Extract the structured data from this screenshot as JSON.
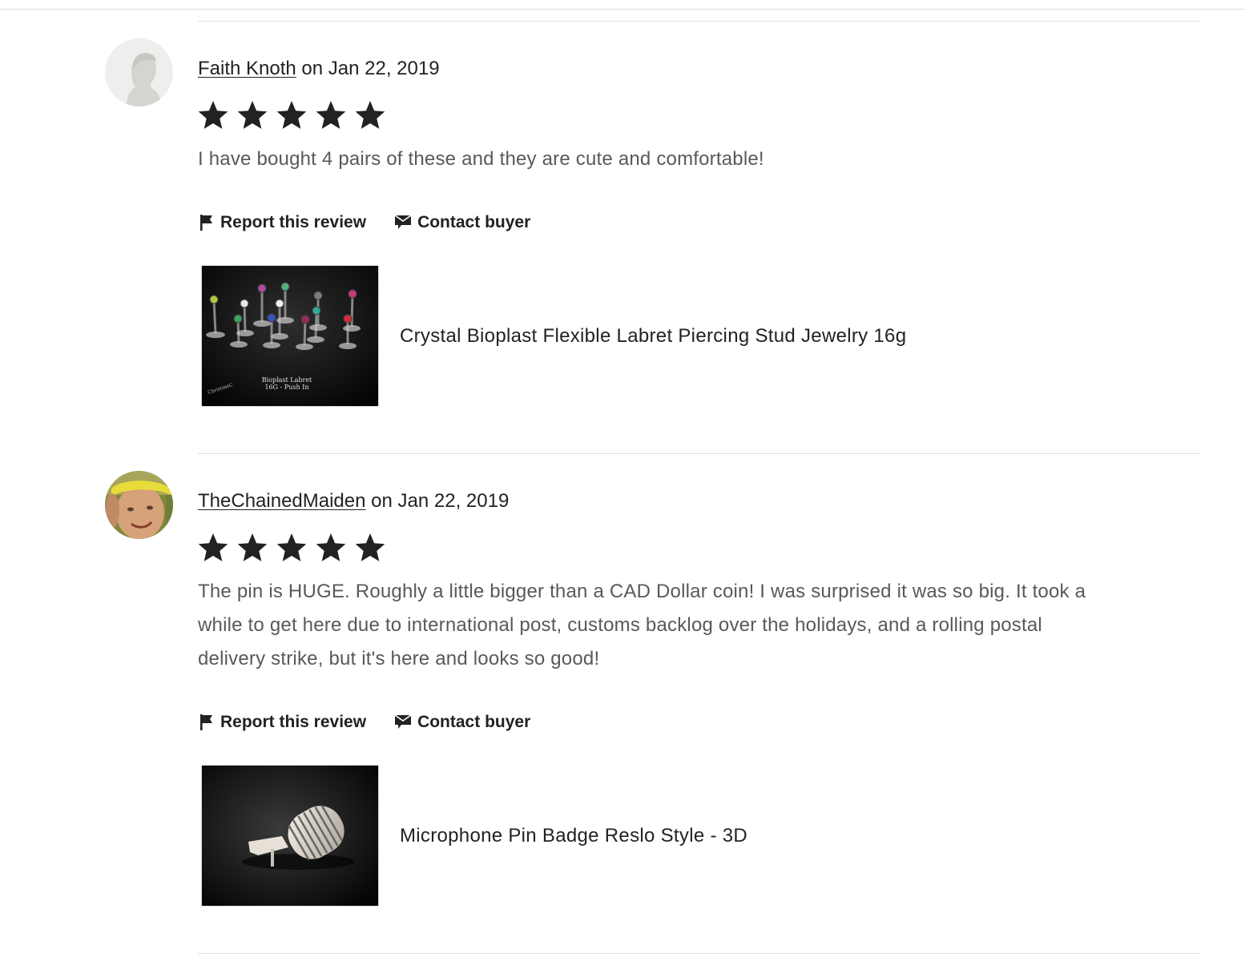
{
  "reviews": [
    {
      "reviewer": "Faith Knoth",
      "date_text": " on Jan 22, 2019",
      "rating": 5,
      "text": "I have bought 4 pairs of these and they are cute and comfortable!",
      "report_label": "Report this review",
      "contact_label": "Contact buyer",
      "listing_title": "Crystal Bioplast Flexible Labret Piercing Stud Jewelry 16g",
      "thumb_caption_1": "Bioplast Labret",
      "thumb_caption_2": "16G - Push In",
      "thumb_signature": "ChristineC"
    },
    {
      "reviewer": "TheChainedMaiden",
      "date_text": " on Jan 22, 2019",
      "rating": 5,
      "text": "The pin is HUGE. Roughly a little bigger than a CAD Dollar coin! I was surprised it was so big. It took a while to get here due to international post, customs backlog over the holidays, and a rolling postal delivery strike, but it's here and looks so good!",
      "report_label": "Report this review",
      "contact_label": "Contact buyer",
      "listing_title": "Microphone Pin Badge Reslo Style - 3D"
    }
  ],
  "colors": {
    "star": "#222222",
    "body_text": "#595959",
    "divider": "#e1e1e1"
  },
  "icons": {
    "star": "star-icon",
    "report": "flag-icon",
    "contact": "message-icon"
  }
}
